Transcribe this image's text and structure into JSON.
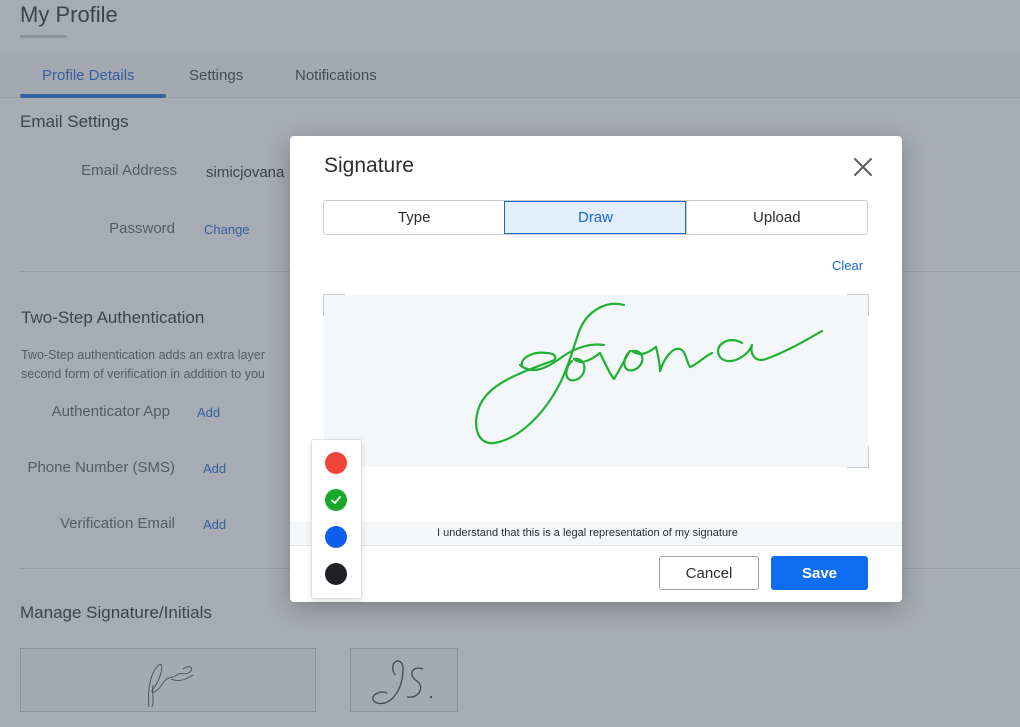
{
  "page": {
    "title": "My Profile",
    "tabs": [
      {
        "label": "Profile Details",
        "active": true
      },
      {
        "label": "Settings",
        "active": false
      },
      {
        "label": "Notifications",
        "active": false
      }
    ],
    "email_settings": {
      "heading": "Email Settings",
      "email_label": "Email Address",
      "email_value": "simicjovana",
      "password_label": "Password",
      "password_action": "Change"
    },
    "two_step": {
      "heading": "Two-Step Authentication",
      "desc_line1": "Two-Step authentication adds an extra layer",
      "desc_line2": "second form of verification in addition to you",
      "items": [
        {
          "label": "Authenticator App",
          "action": "Add"
        },
        {
          "label": "Phone Number (SMS)",
          "action": "Add"
        },
        {
          "label": "Verification Email",
          "action": "Add"
        }
      ]
    },
    "signature_section": {
      "heading": "Manage Signature/Initials"
    }
  },
  "modal": {
    "title": "Signature",
    "segments": [
      {
        "label": "Type",
        "active": false
      },
      {
        "label": "Draw",
        "active": true
      },
      {
        "label": "Upload",
        "active": false
      }
    ],
    "clear_label": "Clear",
    "consent_text": "I understand that this is a legal representation of my signature",
    "cancel_label": "Cancel",
    "save_label": "Save",
    "ink_color": "#20b032"
  },
  "color_picker": {
    "colors": [
      {
        "name": "red",
        "hex": "#f04438",
        "selected": false
      },
      {
        "name": "green",
        "hex": "#18a92a",
        "selected": true
      },
      {
        "name": "blue",
        "hex": "#0b5ff0",
        "selected": false
      },
      {
        "name": "black",
        "hex": "#1f2125",
        "selected": false
      }
    ]
  },
  "colors": {
    "accent": "#1a66d9",
    "primary_button": "#0f6ef0",
    "overlay": "rgba(80,88,104,0.5)"
  }
}
